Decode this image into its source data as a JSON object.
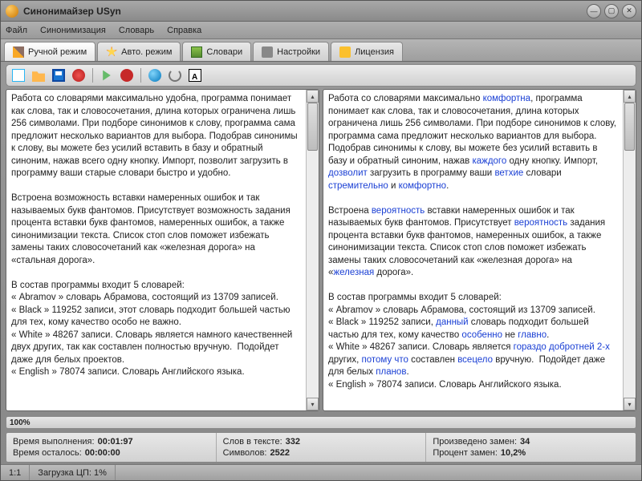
{
  "title": "Синонимайзер USyn",
  "menu": {
    "file": "Файл",
    "syn": "Синонимизация",
    "dict": "Словарь",
    "help": "Справка"
  },
  "tabs": {
    "manual": "Ручной режим",
    "auto": "Авто. режим",
    "dictionaries": "Словари",
    "settings": "Настройки",
    "license": "Лицензия"
  },
  "left_para1": "Работа со словарями максимально удобна, программа понимает как слова, так и словосочетания, длина которых ограничена лишь 256 символами. При подборе синонимов к слову, программа сама предложит несколько вариантов для выбора. Подобрав синонимы к слову, вы можете без усилий вставить в базу и обратный синоним, нажав всего одну кнопку. Импорт, позволит загрузить в программу ваши старые словари быстро и удобно.",
  "left_para2": "Встроена возможность вставки намеренных ошибок и так называемых букв фантомов. Присутствует возможность задания процента вставки букв фантомов, намеренных ошибок, а также синонимизации текста. Список стоп слов поможет избежать замены таких словосочетаний как «железная дорога» на «стальная дорога».",
  "left_para3_l1": "В состав программы входит 5 словарей:",
  "left_para3_l2": "« Abramov » словарь Абрамова, состоящий из 13709 записей.",
  "left_para3_l3": "« Black » 119252 записи, этот словарь подходит большей частью для тех, кому качество особо не важно.",
  "left_para3_l4": "« White » 48267 записи. Словарь является намного качественней двух других, так как составлен полностью вручную.  Подойдет даже для белых проектов.",
  "left_para3_l5": "« English » 78074 записи. Словарь Английского языка.",
  "r": {
    "p1a": "Работа со словарями максимально ",
    "p1b": "комфортна",
    "p1c": ", программа понимает как слова, так и словосочетания, длина которых ограничена лишь 256 символами. При подборе синонимов к слову, программа сама предложит несколько вариантов для выбора. Подобрав синонимы к слову, вы можете без усилий вставить в базу и обратный синоним, нажав ",
    "p1d": "каждого",
    "p1e": " одну кнопку. Импорт, ",
    "p1f": "дозволит",
    "p1g": " загрузить в программу ваши ",
    "p1h": "ветхие",
    "p1i": " словари ",
    "p1j": "стремительно",
    "p1k": " и ",
    "p1l": "комфортно",
    "p1m": ".",
    "p2a": "Встроена ",
    "p2b": "вероятность",
    "p2c": " вставки намеренных ошибок и так называемых букв фантомов. Присутствует ",
    "p2d": "вероятность",
    "p2e": " задания процента вставки букв фантомов, намеренных ошибок, а также синонимизации текста. Список стоп слов поможет избежать замены таких словосочетаний как «железная дорога» на «",
    "p2f": "железная",
    "p2g": " дорога».",
    "p3_l1": "В состав программы входит 5 словарей:",
    "p3_l2": "« Abramov » словарь Абрамова, состоящий из 13709 записей.",
    "p3_l3a": "« Black » 119252 записи, ",
    "p3_l3b": "данный",
    "p3_l3c": " словарь подходит большей частью для тех, кому качество ",
    "p3_l3d": "особенно",
    "p3_l3e": " не ",
    "p3_l3f": "главно",
    "p3_l3g": ".",
    "p3_l4a": "« White » 48267 записи. Словарь является ",
    "p3_l4b": "гораздо добротней 2-х",
    "p3_l4c": " других, ",
    "p3_l4d": "потому что",
    "p3_l4e": " составлен ",
    "p3_l4f": "всецело",
    "p3_l4g": " вручную.  Подойдет даже для белых ",
    "p3_l4h": "планов",
    "p3_l4i": ".",
    "p3_l5": "« English » 78074 записи. Словарь Английского языка."
  },
  "progress": "100%",
  "stats": {
    "time_elapsed_label": "Время выполнения: ",
    "time_elapsed": "00:01:97",
    "time_remaining_label": "Время осталось: ",
    "time_remaining": "00:00:00",
    "words_label": "Слов в тексте: ",
    "words": "332",
    "chars_label": "Символов: ",
    "chars": "2522",
    "replacements_label": "Произведено замен: ",
    "replacements": "34",
    "percent_label": "Процент замен: ",
    "percent": "10,2%"
  },
  "status": {
    "pos": "1:1",
    "cpu": "Загрузка ЦП: 1%"
  }
}
